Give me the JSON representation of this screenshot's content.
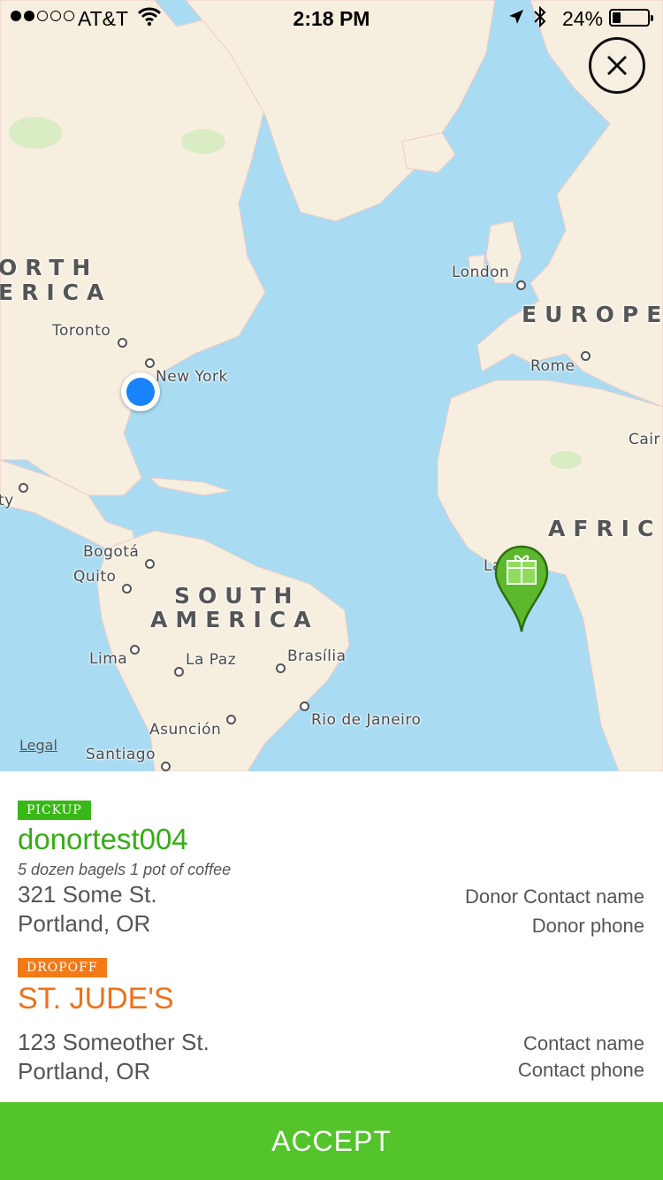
{
  "status_bar": {
    "carrier": "AT&T",
    "time": "2:18 PM",
    "battery": "24%",
    "battery_fraction": 0.24,
    "signal_bars_filled": 2,
    "signal_bars_total": 5,
    "icons": [
      "wifi-icon",
      "location-arrow-icon",
      "bluetooth-icon",
      "battery-icon"
    ]
  },
  "map": {
    "labels": {
      "north_america_1": "ORTH",
      "north_america_2": "ERICA",
      "south_america_1": "SOUTH",
      "south_america_2": "AMERICA",
      "europe": "EUROPE",
      "africa": "AFRIC",
      "toronto": "Toronto",
      "new_york": "New York",
      "london": "London",
      "rome": "Rome",
      "cairo": "Cair",
      "city_edge": "ty",
      "bogota": "Bogotá",
      "quito": "Quito",
      "lima": "Lima",
      "la_paz": "La Paz",
      "brasilia": "Brasília",
      "rio": "Rio de Janeiro",
      "asuncion": "Asunción",
      "santiago": "Santiago",
      "lagos_partial": "La"
    },
    "legal": "Legal",
    "colors": {
      "water": "#a9dcf2",
      "land": "#f6efdf",
      "user_location": "#1a82fb",
      "pin": "#5cb82d"
    }
  },
  "close_button": {
    "icon": "close-icon"
  },
  "pickup": {
    "tag": "PICKUP",
    "name": "donortest004",
    "description": "5 dozen bagels 1 pot of coffee",
    "address_line1": "321 Some St.",
    "address_line2": "Portland, OR",
    "contact_name": "Donor Contact name",
    "contact_phone": "Donor phone"
  },
  "dropoff": {
    "tag": "DROPOFF",
    "name": "ST. JUDE'S",
    "address_line1": "123 Someother St.",
    "address_line2": "Portland, OR",
    "contact_name": "Contact name",
    "contact_phone": "Contact phone"
  },
  "accept_label": "ACCEPT",
  "colors": {
    "pickup_accent": "#38b816",
    "dropoff_accent": "#f37a16",
    "accept_button": "#53c42a"
  }
}
